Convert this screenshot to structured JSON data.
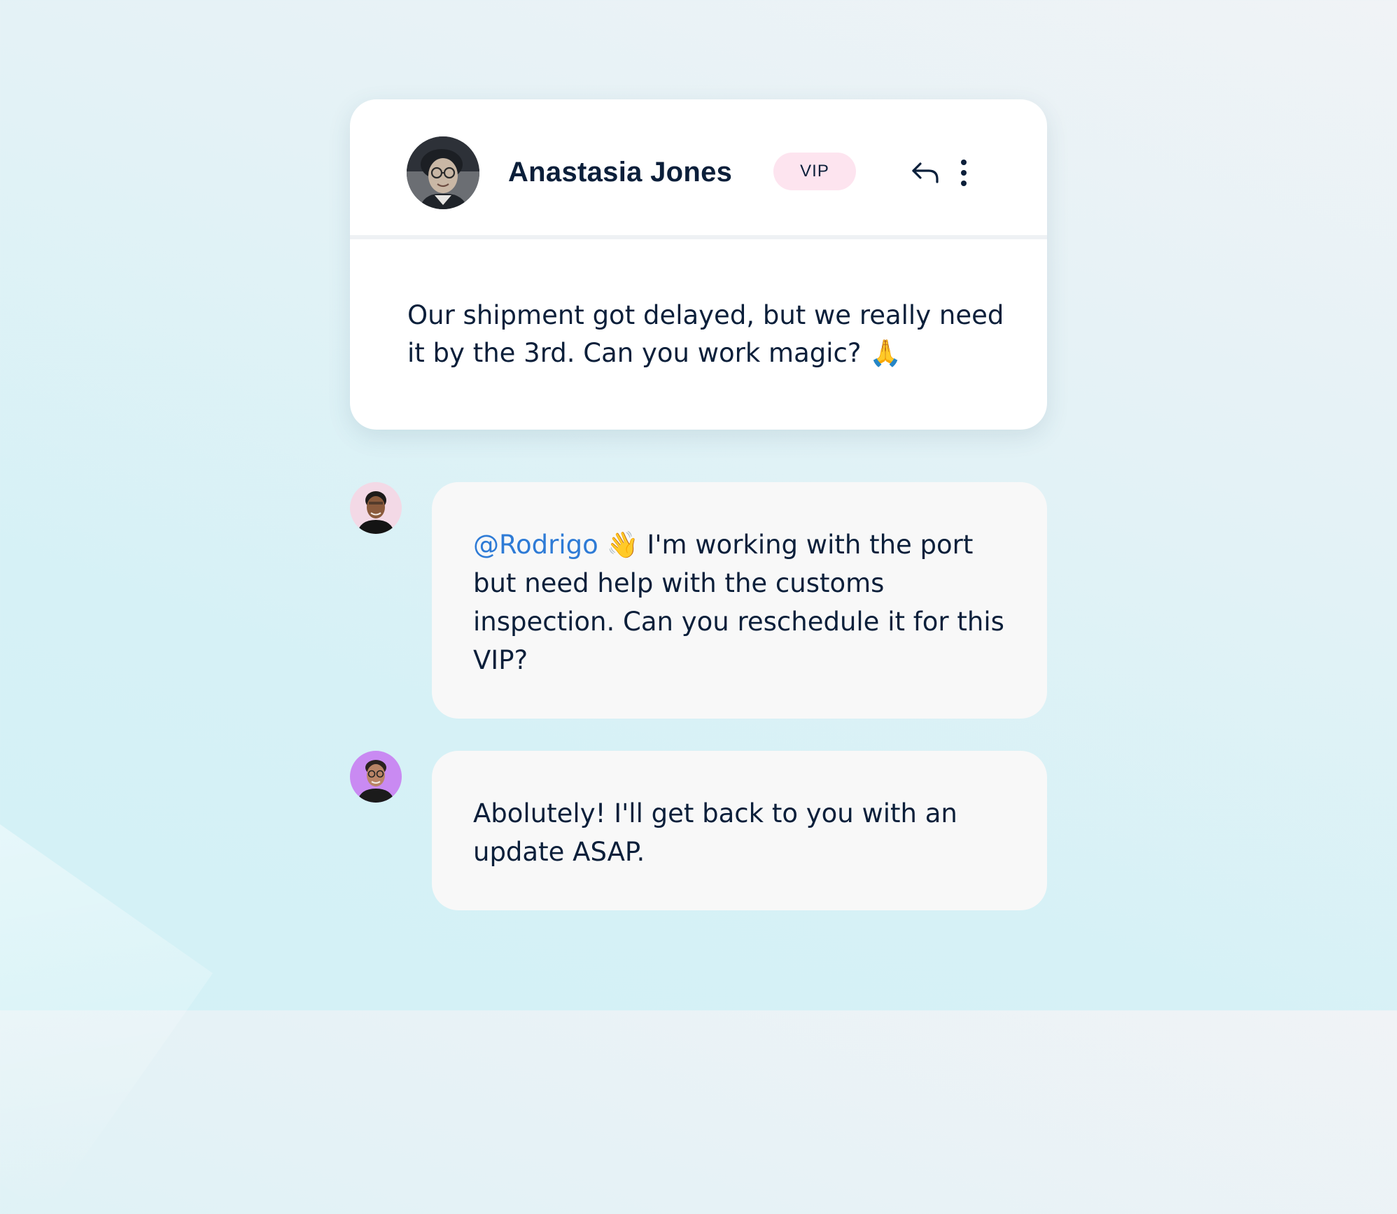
{
  "ticket": {
    "sender_name": "Anastasia Jones",
    "badge": "VIP",
    "message": "Our shipment got delayed, but we really need it by the 3rd. Can you work magic? 🙏",
    "actions": {
      "reply_icon": "reply-icon",
      "more_icon": "more-vertical-icon"
    }
  },
  "comments": [
    {
      "mention": "@Rodrigo",
      "emoji": "👋",
      "text": " I'm working with the port but need help with the customs inspection. Can you reschedule it for this VIP?"
    },
    {
      "text": "Abolutely! I'll get back to you with an update ASAP."
    }
  ],
  "colors": {
    "text": "#0b1f3a",
    "mention": "#2e7bd6",
    "badge_bg": "#fde4ef",
    "bubble_bg": "#f8f8f8",
    "card_bg": "#ffffff"
  }
}
